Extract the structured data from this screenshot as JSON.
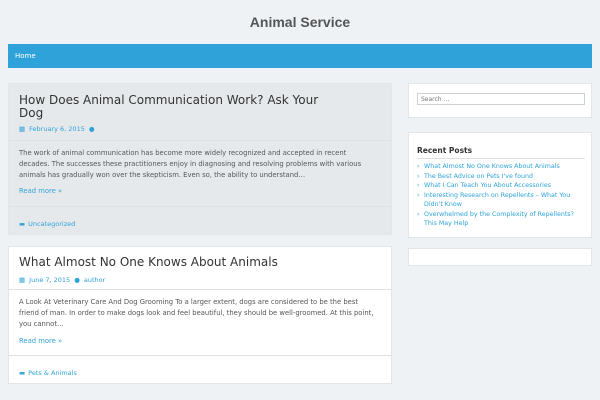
{
  "site": {
    "title": "Animal Service"
  },
  "nav": {
    "items": [
      {
        "label": "Home"
      }
    ]
  },
  "posts": [
    {
      "title": "How Does Animal Communication Work? Ask Your Dog",
      "date": "February 6, 2015",
      "author": "",
      "excerpt": "The work of animal communication has become more widely recognized and accepted in recent decades. The successes these practitioners enjoy in diagnosing and resolving problems with various animals has gradually won over the skepticism. Even so, the ability to understand…",
      "read_more": "Read more »",
      "category": "Uncategorized"
    },
    {
      "title": "What Almost No One Knows About Animals",
      "date": "June 7, 2015",
      "author": "author",
      "excerpt": "A Look At Veterinary Care And Dog Grooming To a larger extent, dogs are considered to be the best friend of man. In order to make dogs look and feel beautiful, they should be well-groomed. At this point, you cannot…",
      "read_more": "Read more »",
      "category": "Pets & Animals"
    }
  ],
  "sidebar": {
    "search": {
      "placeholder": "Search …"
    },
    "recent": {
      "title": "Recent Posts",
      "items": [
        "What Almost No One Knows About Animals",
        "The Best Advice on Pets I've found",
        "What I Can Teach You About Accessories",
        "Interesting Research on Repellents – What You Didn't Know",
        "Overwhelmed by the Complexity of Repellents? This May Help"
      ]
    }
  },
  "colors": {
    "accent": "#2fa3d9",
    "background": "#eef2f5"
  },
  "icons": {
    "date": "calendar-icon",
    "author": "user-icon",
    "category": "folder-icon"
  }
}
